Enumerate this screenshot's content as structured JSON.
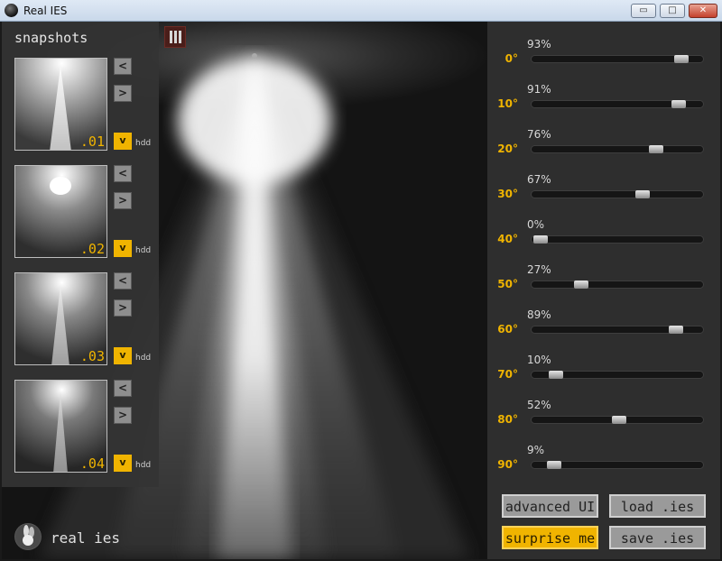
{
  "window": {
    "title": "Real IES",
    "minimize": "▭",
    "maximize": "□",
    "close": "✕"
  },
  "snapshots": {
    "title": "snapshots",
    "items": [
      {
        "label": ".01",
        "prev": "<",
        "next": ">",
        "save": "v",
        "hdd": "hdd"
      },
      {
        "label": ".02",
        "prev": "<",
        "next": ">",
        "save": "v",
        "hdd": "hdd"
      },
      {
        "label": ".03",
        "prev": "<",
        "next": ">",
        "save": "v",
        "hdd": "hdd"
      },
      {
        "label": ".04",
        "prev": "<",
        "next": ">",
        "save": "v",
        "hdd": "hdd"
      }
    ]
  },
  "brand": {
    "name": "real ies"
  },
  "angles": [
    {
      "angle": "0°",
      "value": "93%",
      "level": 0.93
    },
    {
      "angle": "10°",
      "value": "91%",
      "level": 0.91
    },
    {
      "angle": "20°",
      "value": "76%",
      "level": 0.76
    },
    {
      "angle": "30°",
      "value": "67%",
      "level": 0.67
    },
    {
      "angle": "40°",
      "value": "0%",
      "level": 0.0
    },
    {
      "angle": "50°",
      "value": "27%",
      "level": 0.27
    },
    {
      "angle": "60°",
      "value": "89%",
      "level": 0.89
    },
    {
      "angle": "70°",
      "value": "10%",
      "level": 0.1
    },
    {
      "angle": "80°",
      "value": "52%",
      "level": 0.52
    },
    {
      "angle": "90°",
      "value": "9%",
      "level": 0.09
    }
  ],
  "buttons": {
    "advanced": "advanced UI",
    "load": "load .ies",
    "surprise": "surprise me",
    "save": "save .ies"
  },
  "colors": {
    "accent": "#f0b400",
    "panel": "#2e2e2e"
  },
  "icons": {
    "pause": "pause-icon",
    "logo": "rabbit-logo"
  }
}
